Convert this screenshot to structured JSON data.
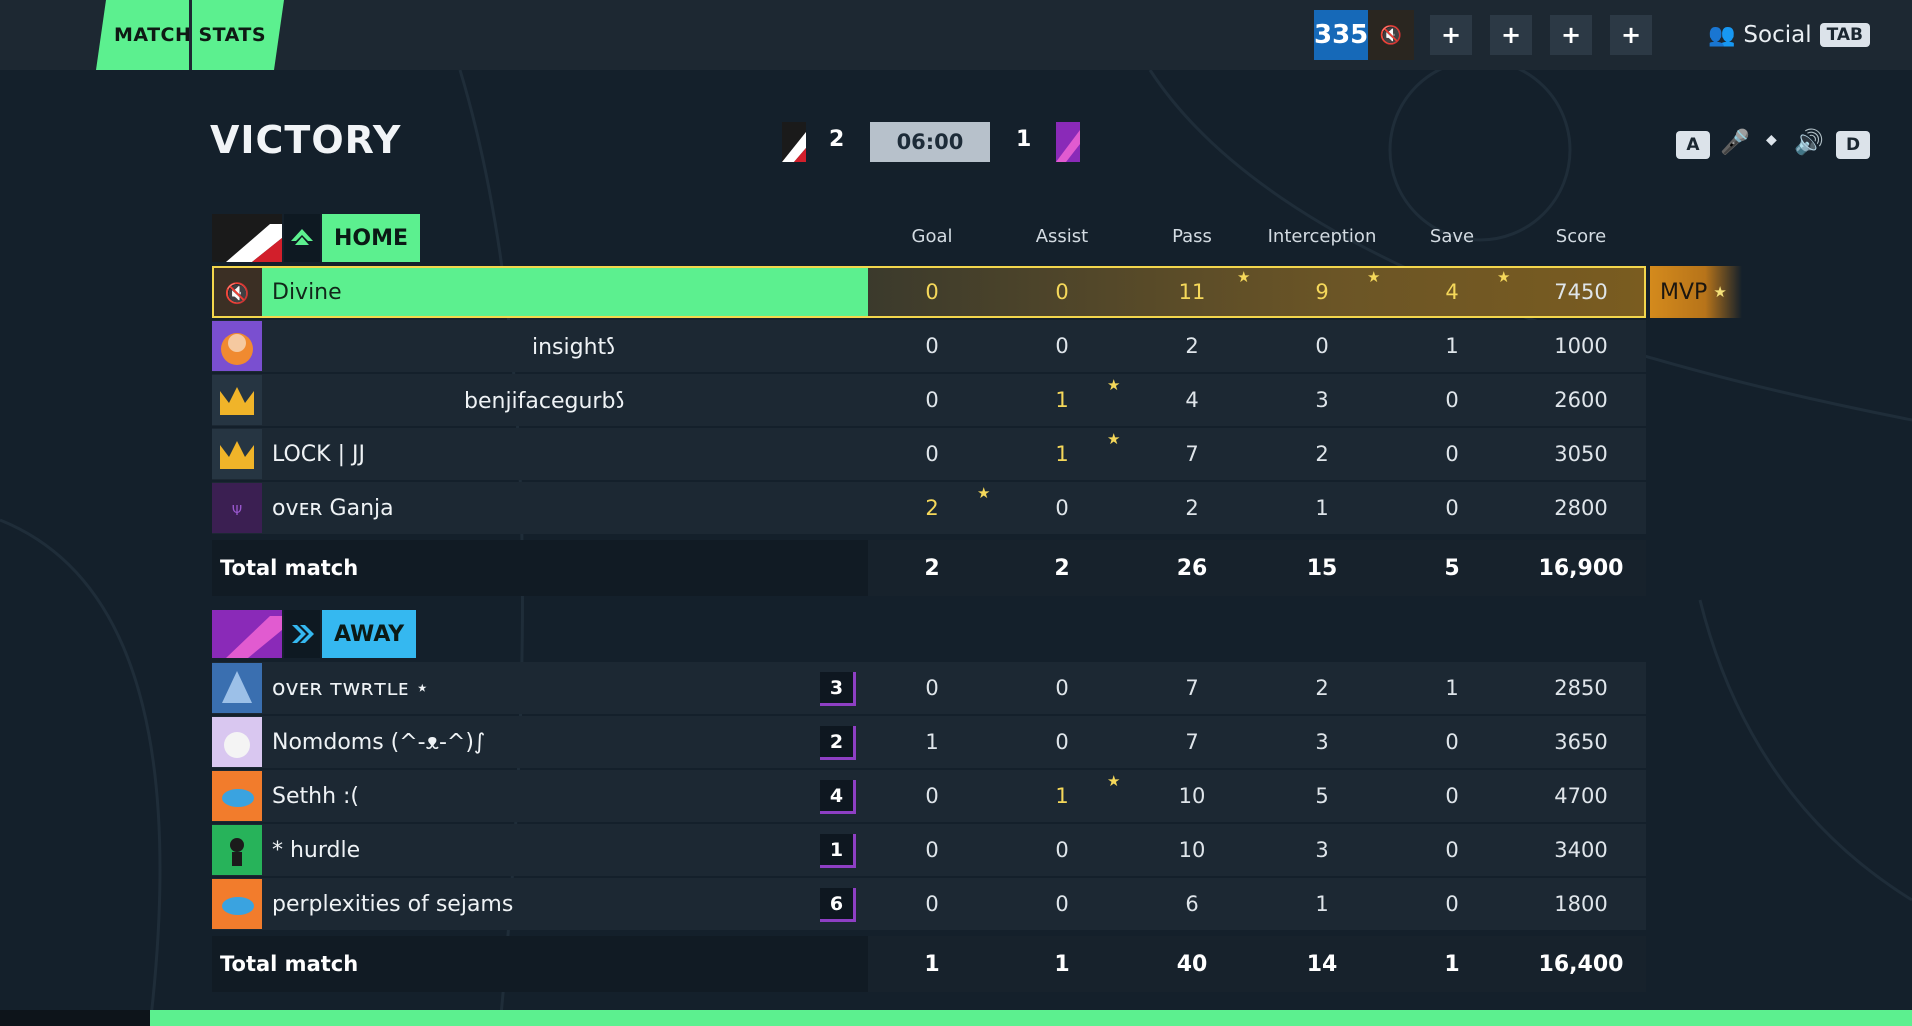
{
  "topbar": {
    "title": "MATCH STATS",
    "level": "335",
    "plus_buttons": [
      "+",
      "+",
      "+",
      "+"
    ],
    "social_label": "Social",
    "social_key": "TAB"
  },
  "header": {
    "result": "VICTORY",
    "home_score": "2",
    "timer": "06:00",
    "away_score": "1",
    "left_key": "A",
    "right_key": "D"
  },
  "columns": [
    "Goal",
    "Assist",
    "Pass",
    "Interception",
    "Save",
    "Score"
  ],
  "home": {
    "name": "HOME",
    "color": "#5cf08f",
    "players": [
      {
        "name": "Divine",
        "stats": [
          "0",
          "0",
          "11",
          "9",
          "4",
          "7450"
        ]
      },
      {
        "name": "insight𐑕",
        "stats": [
          "0",
          "0",
          "2",
          "0",
          "1",
          "1000"
        ]
      },
      {
        "name": "benjifacegurb𐑕",
        "stats": [
          "0",
          "1",
          "4",
          "3",
          "0",
          "2600"
        ]
      },
      {
        "name": "LOCK | JJ",
        "stats": [
          "0",
          "1",
          "7",
          "2",
          "0",
          "3050"
        ]
      },
      {
        "name": "ᴏᴠᴇʀ Ganja",
        "stats": [
          "2",
          "0",
          "2",
          "1",
          "0",
          "2800"
        ]
      }
    ],
    "total_label": "Total match",
    "totals": [
      "2",
      "2",
      "26",
      "15",
      "5",
      "16,900"
    ]
  },
  "away": {
    "name": "AWAY",
    "color": "#35b8f0",
    "players": [
      {
        "name": "ᴏᴠᴇʀ ᴛᴡʀᴛʟᴇ ⋆",
        "rank": "3",
        "stats": [
          "0",
          "0",
          "7",
          "2",
          "1",
          "2850"
        ]
      },
      {
        "name": "Nomdoms (^-ᴥ-^)∫",
        "rank": "2",
        "stats": [
          "1",
          "0",
          "7",
          "3",
          "0",
          "3650"
        ]
      },
      {
        "name": "Sethh :(",
        "rank": "4",
        "stats": [
          "0",
          "1",
          "10",
          "5",
          "0",
          "4700"
        ]
      },
      {
        "name": "* hurdle",
        "rank": "1",
        "stats": [
          "0",
          "0",
          "10",
          "3",
          "0",
          "3400"
        ]
      },
      {
        "name": "perplexities of sejams",
        "rank": "6",
        "stats": [
          "0",
          "0",
          "6",
          "1",
          "0",
          "1800"
        ]
      }
    ],
    "total_label": "Total match",
    "totals": [
      "1",
      "1",
      "40",
      "14",
      "1",
      "16,400"
    ]
  },
  "mvp_label": "MVP",
  "star_glyph": "★"
}
